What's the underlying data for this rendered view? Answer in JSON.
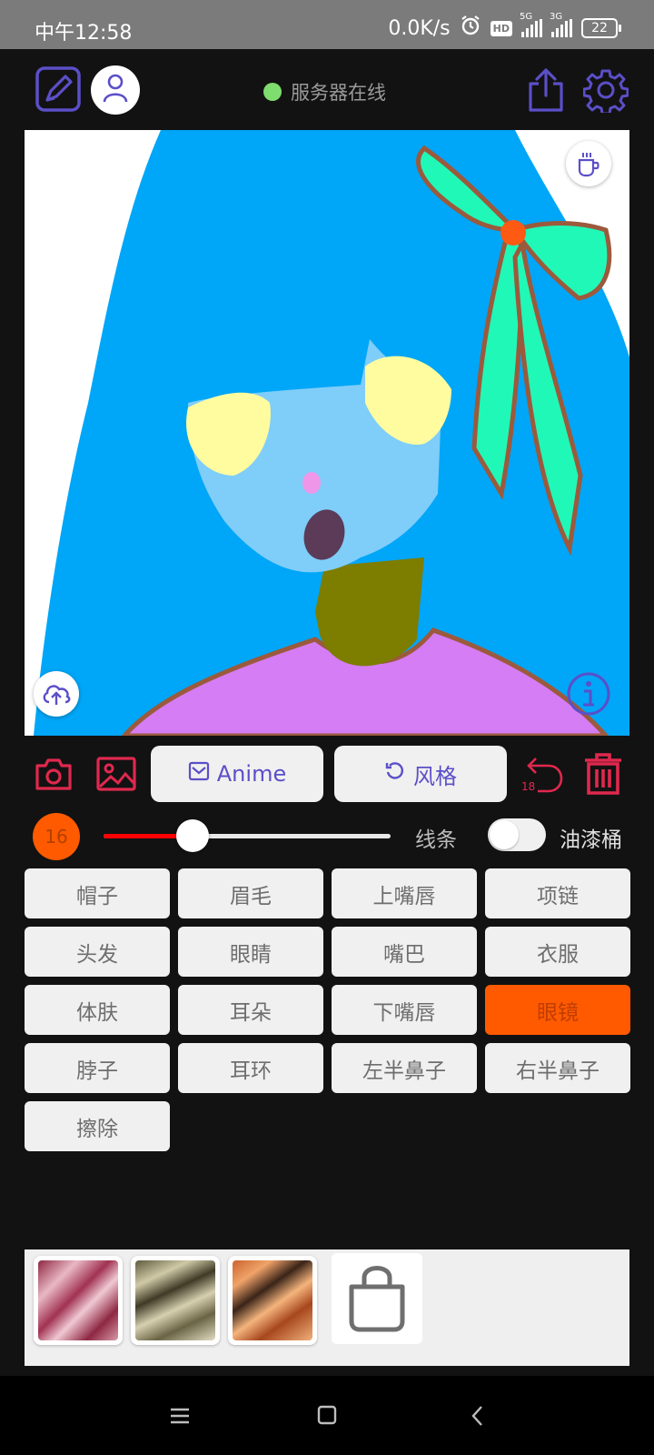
{
  "status_bar": {
    "time": "中午12:58",
    "speed": "0.0K/s",
    "hd": "HD",
    "net1": "5G",
    "net2": "3G",
    "battery": "22"
  },
  "header": {
    "server_status": "服务器在线",
    "server_status_color": "#7fdc6e",
    "icons": [
      "sketch-pad-icon",
      "user-icon",
      "share-icon",
      "settings-icon"
    ]
  },
  "canvas": {
    "top_right_icon": "coffee-cup-icon",
    "bottom_left_icon": "cloud-upload-icon",
    "bottom_right_icon": "info-icon"
  },
  "toolbar": {
    "anime_label": "Anime",
    "style_label": "风格",
    "undo_count": "18",
    "accent": "#e0284e",
    "brand": "#5b4fc8"
  },
  "brush": {
    "size": "16",
    "size_fraction": 0.31,
    "lines_label": "线条",
    "bucket_label": "油漆桶",
    "bucket_enabled": false
  },
  "parts": [
    {
      "label": "帽子",
      "active": false
    },
    {
      "label": "眉毛",
      "active": false
    },
    {
      "label": "上嘴唇",
      "active": false
    },
    {
      "label": "项链",
      "active": false
    },
    {
      "label": "头发",
      "active": false
    },
    {
      "label": "眼睛",
      "active": false
    },
    {
      "label": "嘴巴",
      "active": false
    },
    {
      "label": "衣服",
      "active": false
    },
    {
      "label": "体肤",
      "active": false
    },
    {
      "label": "耳朵",
      "active": false
    },
    {
      "label": "下嘴唇",
      "active": false
    },
    {
      "label": "眼镜",
      "active": true
    },
    {
      "label": "脖子",
      "active": false
    },
    {
      "label": "耳环",
      "active": false
    },
    {
      "label": "左半鼻子",
      "active": false
    },
    {
      "label": "右半鼻子",
      "active": false
    },
    {
      "label": "擦除",
      "active": false
    }
  ],
  "tray": {
    "thumbnails": [
      "style-thumbnail-pink",
      "style-thumbnail-olive",
      "style-thumbnail-orange"
    ],
    "shop_icon": "shopping-bag-icon"
  },
  "nav": [
    "menu-icon",
    "home-icon",
    "back-icon"
  ]
}
